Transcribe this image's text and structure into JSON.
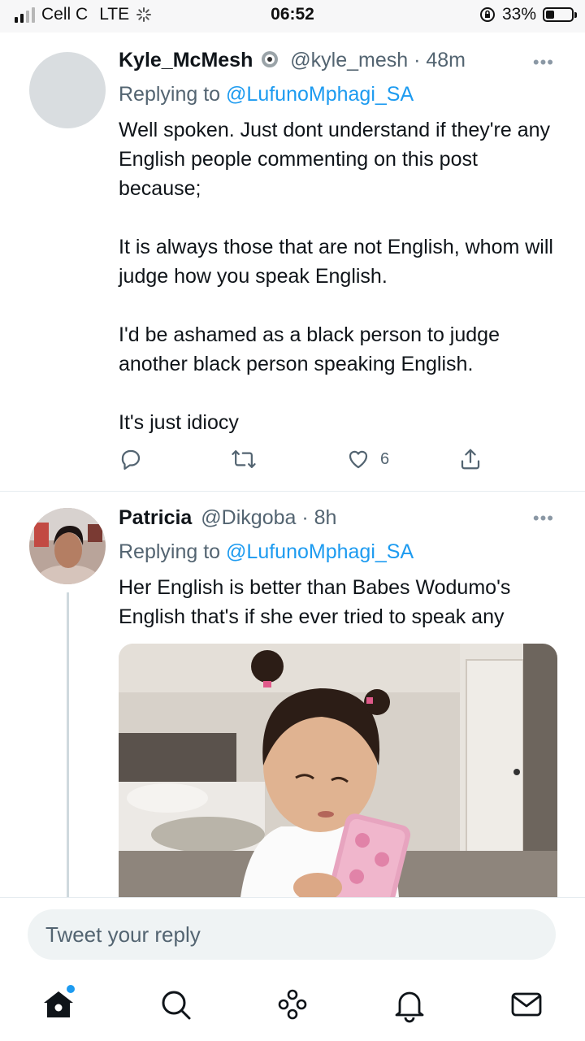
{
  "status_bar": {
    "carrier": "Cell C",
    "network": "LTE",
    "time": "06:52",
    "battery": "33%",
    "battery_level": 0.33
  },
  "tweets": [
    {
      "name": "Kyle_McMesh",
      "handle": "@kyle_mesh",
      "separator": "·",
      "time": "48m",
      "replying_prefix": "Replying to",
      "replying_to": "@LufunoMphagi_SA",
      "text": "Well spoken. Just dont understand if they're any English people commenting on this post because;\n\nIt is always those that are not English, whom will judge how you speak English.\n\nI'd be ashamed as a black person to judge another black person speaking English.\n\nIt's just idiocy",
      "likes": "6",
      "more": "•••"
    },
    {
      "name": "Patricia",
      "handle": "@Dikgoba",
      "separator": "·",
      "time": "8h",
      "replying_prefix": "Replying to",
      "replying_to": "@LufunoMphagi_SA",
      "text": "Her English is better than Babes Wodumo's English that's if she ever tried to speak any",
      "more": "•••"
    }
  ],
  "reply_bar": {
    "placeholder": "Tweet your reply"
  },
  "nav": {
    "items": [
      "home-icon",
      "search-icon",
      "spaces-icon",
      "notifications-icon",
      "messages-icon"
    ]
  },
  "colors": {
    "accent": "#1d9bf0",
    "text": "#0f1419",
    "muted": "#536471"
  }
}
